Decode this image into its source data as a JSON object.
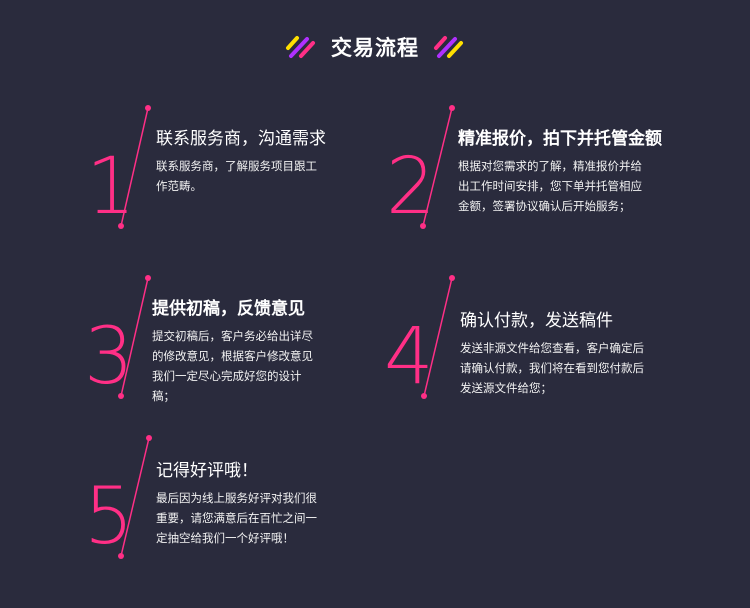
{
  "header": {
    "title": "交易流程",
    "accent_colors": [
      "#ffe000",
      "#b030ff",
      "#ff2f86"
    ]
  },
  "theme": {
    "background": "#2a2b3d",
    "accent": "#ff2f86"
  },
  "steps": [
    {
      "number": "1",
      "heading": "联系服务商，沟通需求",
      "description": "联系服务商，了解服务项目跟工作范畴。"
    },
    {
      "number": "2",
      "heading": "精准报价，拍下并托管金额",
      "description": "根据对您需求的了解，精准报价并给出工作时间安排，您下单并托管相应金额，签署协议确认后开始服务；"
    },
    {
      "number": "3",
      "heading": "提供初稿，反馈意见",
      "description": "提交初稿后，客户务必给出详尽的修改意见，根据客户修改意见我们一定尽心完成好您的设计稿；"
    },
    {
      "number": "4",
      "heading": "确认付款，发送稿件",
      "description": "发送非源文件给您查看，客户确定后请确认付款，我们将在看到您付款后发送源文件给您；"
    },
    {
      "number": "5",
      "heading": "记得好评哦！",
      "description": "最后因为线上服务好评对我们很重要，请您满意后在百忙之间一定抽空给我们一个好评哦！"
    }
  ]
}
